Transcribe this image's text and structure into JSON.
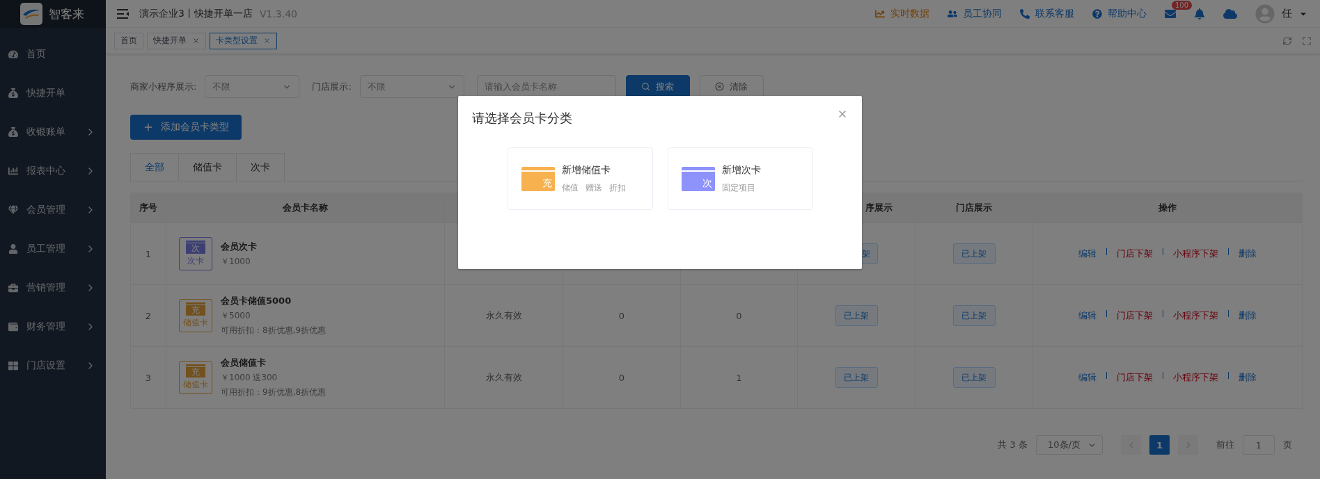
{
  "sidebar": {
    "brand": "智客来",
    "items": [
      {
        "label": "首页",
        "expandable": false
      },
      {
        "label": "快捷开单",
        "expandable": false
      },
      {
        "label": "收银账单",
        "expandable": true
      },
      {
        "label": "报表中心",
        "expandable": true
      },
      {
        "label": "会员管理",
        "expandable": true
      },
      {
        "label": "员工管理",
        "expandable": true
      },
      {
        "label": "营销管理",
        "expandable": true
      },
      {
        "label": "财务管理",
        "expandable": true
      },
      {
        "label": "门店设置",
        "expandable": true
      }
    ]
  },
  "topbar": {
    "title": "演示企业3丨快捷开单一店",
    "version": "V1.3.40",
    "links": [
      {
        "label": "实时数据",
        "kind": "highlight"
      },
      {
        "label": "员工协同",
        "kind": "normal"
      },
      {
        "label": "联系客服",
        "kind": "normal"
      },
      {
        "label": "帮助中心",
        "kind": "normal"
      }
    ],
    "mail_badge": "100",
    "user": "任"
  },
  "page_tags": [
    {
      "label": "首页",
      "closable": false,
      "selected": false
    },
    {
      "label": "快捷开单",
      "closable": true,
      "selected": false
    },
    {
      "label": "卡类型设置",
      "closable": true,
      "selected": true
    }
  ],
  "filter": {
    "fields": [
      {
        "kind": "select",
        "label": "商家小程序展示:",
        "placeholder": "不限"
      },
      {
        "kind": "select",
        "label": "门店展示:",
        "placeholder": "不限"
      },
      {
        "kind": "input",
        "placeholder": "请输入会员卡名称"
      }
    ],
    "search": "搜索",
    "clear": "清除"
  },
  "add_button": "添加会员卡类型",
  "tabs": [
    {
      "label": "全部",
      "selected": true
    },
    {
      "label": "储值卡",
      "selected": false
    },
    {
      "label": "次卡",
      "selected": false
    }
  ],
  "table": {
    "columns": [
      "序号",
      "会员卡名称",
      null,
      null,
      null,
      "序展示",
      "门店展示",
      "操作"
    ],
    "rows": [
      {
        "index": "1",
        "card": {
          "kind": "times",
          "glyph": "次",
          "type_label": "次卡",
          "name": "会员次卡",
          "price": "￥1000"
        },
        "mini_status": "架",
        "store_status": "已上架",
        "actions": [
          {
            "label": "编辑",
            "kind": "primary"
          },
          {
            "label": "门店下架",
            "kind": "danger"
          },
          {
            "label": "小程序下架",
            "kind": "danger"
          },
          {
            "label": "删除",
            "kind": "primary"
          }
        ]
      },
      {
        "index": "2",
        "card": {
          "kind": "stored",
          "glyph": "充",
          "type_label": "储值卡",
          "name": "会员卡储值5000",
          "price": "￥5000",
          "discount": "可用折扣：8折优惠,9折优惠"
        },
        "validity": "永久有效",
        "column_4": "0",
        "column_5": "0",
        "mini_status": "已上架",
        "store_status": "已上架",
        "actions": [
          {
            "label": "编辑",
            "kind": "primary"
          },
          {
            "label": "门店下架",
            "kind": "danger"
          },
          {
            "label": "小程序下架",
            "kind": "danger"
          },
          {
            "label": "删除",
            "kind": "primary"
          }
        ]
      },
      {
        "index": "3",
        "card": {
          "kind": "stored",
          "glyph": "充",
          "type_label": "储值卡",
          "name": "会员储值卡",
          "price": "￥1000 送300",
          "discount": "可用折扣：9折优惠,8折优惠"
        },
        "validity": "永久有效",
        "column_4": "0",
        "column_5": "1",
        "mini_status": "已上架",
        "store_status": "已上架",
        "actions": [
          {
            "label": "编辑",
            "kind": "primary"
          },
          {
            "label": "门店下架",
            "kind": "danger"
          },
          {
            "label": "小程序下架",
            "kind": "danger"
          },
          {
            "label": "删除",
            "kind": "primary"
          }
        ]
      }
    ]
  },
  "pagination": {
    "total": "共 3 条",
    "page_size": "10条/页",
    "pages": [
      {
        "label": "1",
        "selected": true
      }
    ],
    "goto_label": "前往",
    "goto_value": "1",
    "page_label": "页"
  },
  "modal": {
    "title": "请选择会员卡分类",
    "options": [
      {
        "kind": "stored",
        "glyph": "充",
        "title": "新增储值卡",
        "tags": [
          "储值",
          "赠送",
          "折扣"
        ]
      },
      {
        "kind": "times",
        "glyph": "次",
        "title": "新增次卡",
        "tags": [
          "固定项目"
        ]
      }
    ]
  }
}
